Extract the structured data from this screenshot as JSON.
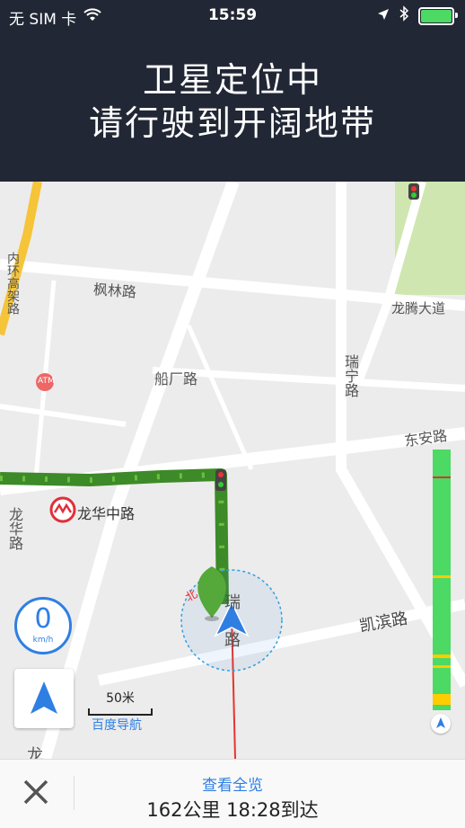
{
  "status": {
    "carrier": "无 SIM 卡",
    "time": "15:59",
    "battery_level": 1.0
  },
  "header": {
    "line1": "卫星定位中",
    "line2": "请行驶到开阔地带"
  },
  "map": {
    "labels": {
      "ring_road": "内环高架路",
      "fenglin": "枫林路",
      "longteng": "龙腾大道",
      "ruining": "瑞宁路",
      "chuanchang": "船厂路",
      "atm": "ATM",
      "dongan": "东安路",
      "metro_station": "龙华中路",
      "longhua": "龙华路",
      "kaibin": "凯滨路",
      "rui": "瑞",
      "lu": "路",
      "north": "北",
      "bottom_left": "龙"
    },
    "speed": {
      "value": "0",
      "unit": "km/h"
    },
    "scale_label": "50米",
    "brand": "百度导航",
    "colors": {
      "route": "#3d8a28",
      "accent": "#2f7fe3",
      "traffic_green": "#4cd964",
      "traffic_yellow": "#ffcc00",
      "metro_red": "#e0303a"
    }
  },
  "bottom": {
    "overview": "查看全览",
    "trip_info": "162公里 18:28到达"
  }
}
